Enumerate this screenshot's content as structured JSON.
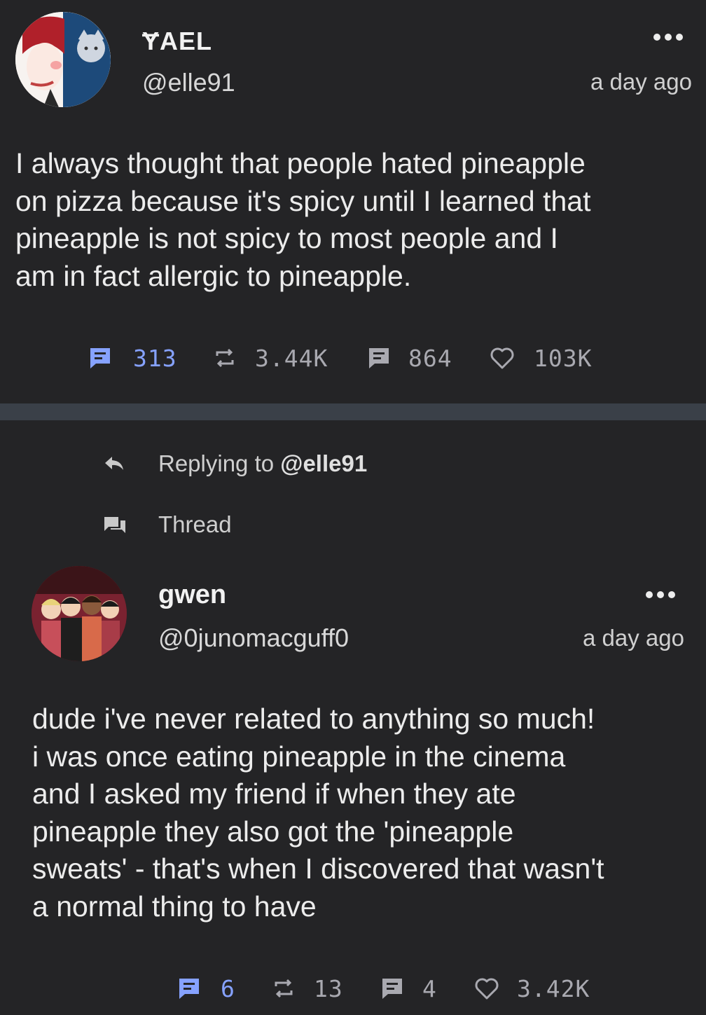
{
  "post": {
    "display_name": "ɎAEL",
    "handle": "@elle91",
    "time": "a day ago",
    "text": "I always thought that people hated pineapple\non pizza because it's spicy until I learned that\npineapple is not spicy to most people and I\nam in fact allergic to pineapple.",
    "stats": {
      "replies": "313",
      "reblogs": "3.44K",
      "quotes": "864",
      "likes": "103K"
    }
  },
  "reply_meta": {
    "replying_prefix": "Replying to ",
    "replying_handle": "@elle91",
    "thread_label": "Thread"
  },
  "reply": {
    "display_name": "gwen",
    "handle": "@0junomacguff0",
    "time": "a day ago",
    "text": "dude i've never related to anything so much!\ni was once eating pineapple in the cinema\nand I asked my friend if when they ate\npineapple they also got the 'pineapple\nsweats' - that's when I discovered that wasn't\na normal thing to have",
    "stats": {
      "replies": "6",
      "reblogs": "13",
      "quotes": "4",
      "likes": "3.42K"
    }
  },
  "colors": {
    "background": "#242426",
    "divider": "#3a4048",
    "reply_accent": "#86a2ff",
    "stat_gray": "#a9a9b0"
  },
  "icons": {
    "more": "ellipsis-icon",
    "reply": "comment-icon",
    "reblog": "repeat-icon",
    "quote": "quote-icon",
    "like": "heart-icon",
    "replying": "reply-arrow-icon",
    "thread": "thread-icon"
  }
}
